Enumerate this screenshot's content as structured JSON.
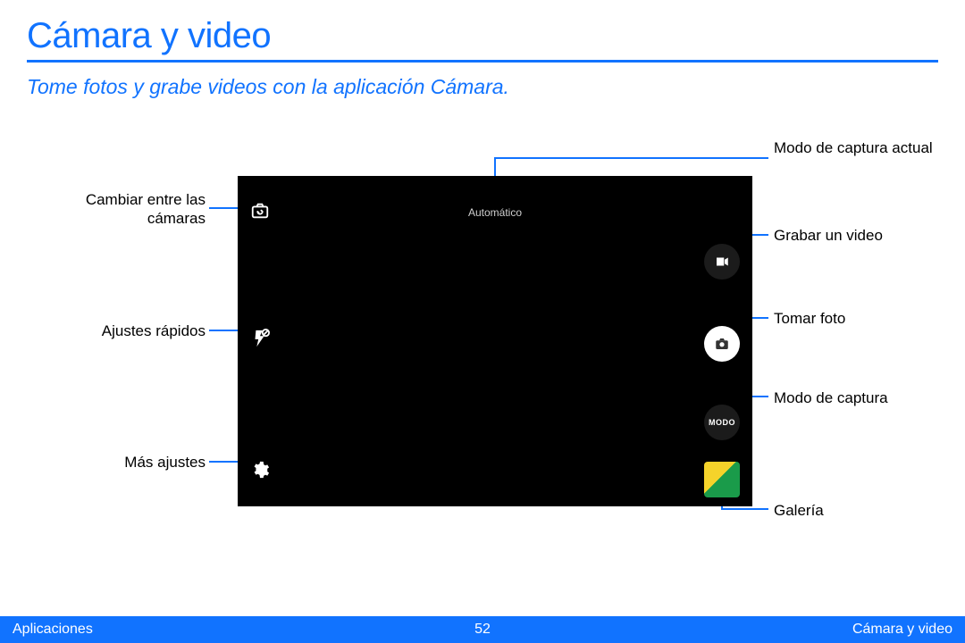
{
  "title": "Cámara y video",
  "subtitle": "Tome fotos y grabe videos con la aplicación Cámara.",
  "screen": {
    "mode_label": "Automático",
    "mode_button_text": "MODO"
  },
  "callouts": {
    "left": {
      "switch_camera": "Cambiar entre las cámaras",
      "quick_settings": "Ajustes rápidos",
      "more_settings": "Más ajustes"
    },
    "right": {
      "current_mode": "Modo de captura actual",
      "record_video": "Grabar un video",
      "take_photo": "Tomar foto",
      "capture_mode": "Modo de captura",
      "gallery": "Galería"
    }
  },
  "footer": {
    "left": "Aplicaciones",
    "page": "52",
    "right": "Cámara y video"
  }
}
